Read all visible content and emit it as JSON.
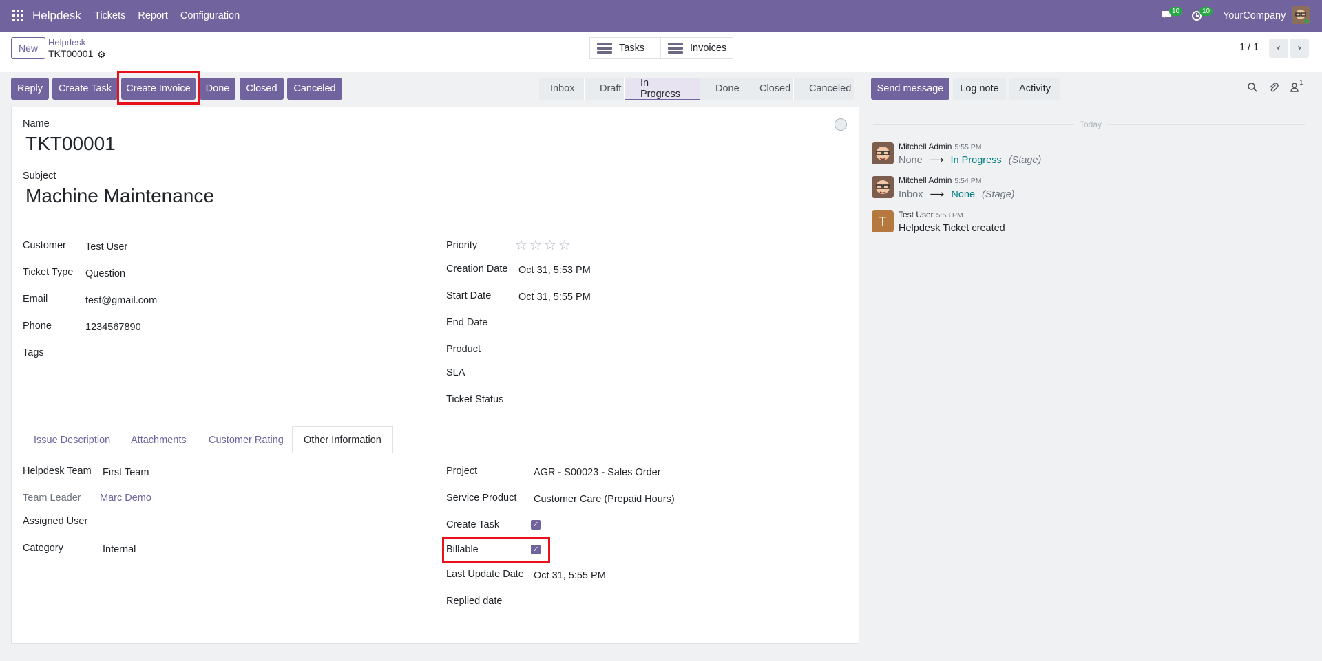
{
  "navbar": {
    "app_name": "Helpdesk",
    "menu": [
      "Tickets",
      "Report",
      "Configuration"
    ],
    "messages_count": "10",
    "activities_count": "10",
    "company": "YourCompany"
  },
  "control_panel": {
    "new_label": "New",
    "breadcrumb_parent": "Helpdesk",
    "breadcrumb_current": "TKT00001",
    "smart_buttons": [
      "Tasks",
      "Invoices"
    ],
    "pager": "1 / 1"
  },
  "actions": {
    "buttons": [
      "Reply",
      "Create Task",
      "Create Invoice",
      "Done",
      "Closed",
      "Canceled"
    ],
    "highlighted": "Create Invoice"
  },
  "stages": {
    "items": [
      "Inbox",
      "Draft",
      "In Progress",
      "Done",
      "Closed",
      "Canceled"
    ],
    "active": "In Progress"
  },
  "form": {
    "name_label": "Name",
    "name": "TKT00001",
    "subject_label": "Subject",
    "subject": "Machine Maintenance",
    "left_fields": [
      {
        "label": "Customer",
        "value": "Test User"
      },
      {
        "label": "Ticket Type",
        "value": "Question"
      },
      {
        "label": "Email",
        "value": "test@gmail.com"
      },
      {
        "label": "Phone",
        "value": "1234567890"
      },
      {
        "label": "Tags",
        "value": ""
      }
    ],
    "right_fields": [
      {
        "label": "Priority",
        "value": ""
      },
      {
        "label": "Creation Date",
        "value": "Oct 31, 5:53 PM"
      },
      {
        "label": "Start Date",
        "value": "Oct 31, 5:55 PM"
      },
      {
        "label": "End Date",
        "value": ""
      },
      {
        "label": "Product",
        "value": ""
      },
      {
        "label": "SLA",
        "value": ""
      },
      {
        "label": "Ticket Status",
        "value": ""
      }
    ],
    "priority_stars": 0,
    "tabs": [
      "Issue Description",
      "Attachments",
      "Customer Rating",
      "Other Information"
    ],
    "active_tab": "Other Information",
    "other_left": [
      {
        "label": "Helpdesk Team",
        "value": "First Team"
      },
      {
        "label": "Team Leader",
        "value": "Marc Demo"
      },
      {
        "label": "Assigned User",
        "value": ""
      },
      {
        "label": "Category",
        "value": "Internal"
      }
    ],
    "other_right": [
      {
        "label": "Project",
        "value": "AGR - S00023 - Sales Order"
      },
      {
        "label": "Service Product",
        "value": "Customer Care (Prepaid Hours)"
      },
      {
        "label": "Create Task",
        "value": "checked"
      },
      {
        "label": "Billable",
        "value": "checked"
      },
      {
        "label": "Last Update Date",
        "value": "Oct 31, 5:55 PM"
      },
      {
        "label": "Replied date",
        "value": ""
      }
    ]
  },
  "chatter": {
    "buttons": [
      "Send message",
      "Log note",
      "Activity"
    ],
    "followers_count": "1",
    "date_separator": "Today",
    "messages": [
      {
        "author": "Mitchell Admin",
        "time": "5:55 PM",
        "old": "None",
        "new": "In Progress",
        "field": "(Stage)"
      },
      {
        "author": "Mitchell Admin",
        "time": "5:54 PM",
        "old": "Inbox",
        "new": "None",
        "field": "(Stage)"
      },
      {
        "author": "Test User",
        "time": "5:53 PM",
        "body": "Helpdesk Ticket created",
        "initial": "T"
      }
    ]
  },
  "colors": {
    "brand": "#71639e",
    "highlight": "#e8101a",
    "tracking_new": "#017e84"
  }
}
